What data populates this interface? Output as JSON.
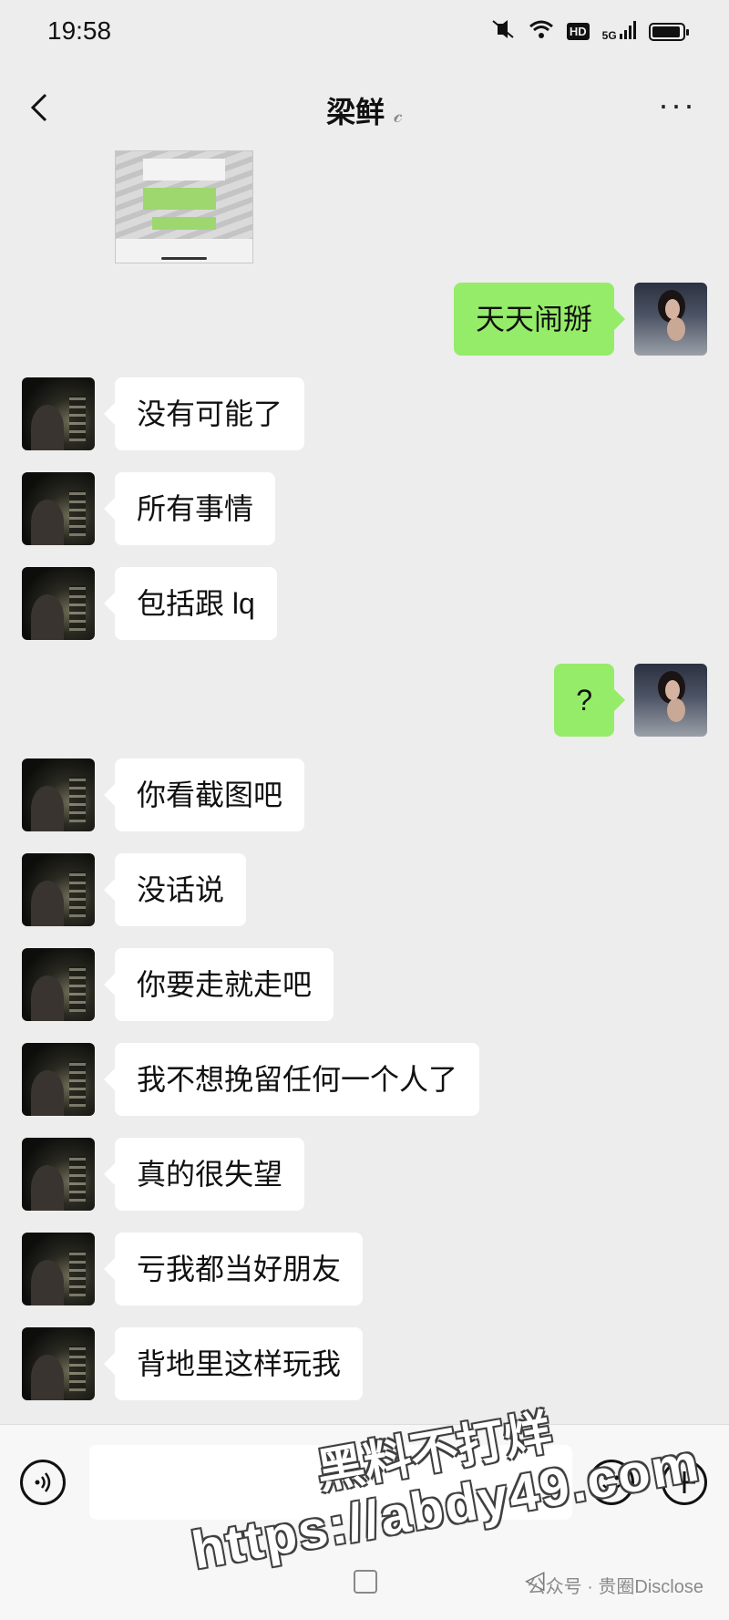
{
  "status_bar": {
    "time": "19:58",
    "network_badge": "HD",
    "signal_label": "5G"
  },
  "header": {
    "contact_name": "梁鲜",
    "ear_icon": "ear-icon",
    "more": "···"
  },
  "messages": [
    {
      "side": "self",
      "text": "天天闹掰"
    },
    {
      "side": "other",
      "text": "没有可能了"
    },
    {
      "side": "other",
      "text": "所有事情"
    },
    {
      "side": "other",
      "text": "包括跟 lq"
    },
    {
      "side": "self",
      "text": "?"
    },
    {
      "side": "other",
      "text": "你看截图吧"
    },
    {
      "side": "other",
      "text": "没话说"
    },
    {
      "side": "other",
      "text": "你要走就走吧"
    },
    {
      "side": "other",
      "text": "我不想挽留任何一个人了"
    },
    {
      "side": "other",
      "text": "真的很失望"
    },
    {
      "side": "other",
      "text": "亏我都当好朋友"
    },
    {
      "side": "other",
      "text": "背地里这样玩我"
    }
  ],
  "input_bar": {
    "placeholder": ""
  },
  "watermark": {
    "line1": "黑料不打烊",
    "line2": "https://abdy49.com",
    "source": "公众号 · 贵圈Disclose"
  }
}
